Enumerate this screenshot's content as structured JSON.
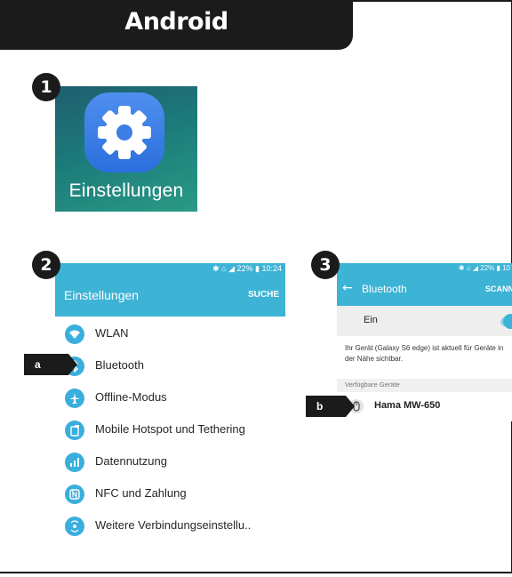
{
  "header": {
    "title": "Android"
  },
  "steps": {
    "step1": "1",
    "step2": "2",
    "step3": "3"
  },
  "app_tile": {
    "label": "Einstellungen",
    "icon": "gear-icon"
  },
  "screen2": {
    "status": "✱ ⌂ ◢ 22% ▮ 10:24",
    "title": "Einstellungen",
    "search": "SUCHE",
    "items": [
      {
        "label": "WLAN",
        "icon": "wifi-icon"
      },
      {
        "label": "Bluetooth",
        "icon": "bluetooth-icon"
      },
      {
        "label": "Offline-Modus",
        "icon": "airplane-icon"
      },
      {
        "label": "Mobile Hotspot und Tethering",
        "icon": "hotspot-icon"
      },
      {
        "label": "Datennutzung",
        "icon": "data-usage-icon"
      },
      {
        "label": "NFC und Zahlung",
        "icon": "nfc-icon"
      },
      {
        "label": "Weitere Verbindungseinstellu..",
        "icon": "more-connections-icon"
      }
    ]
  },
  "screen3": {
    "status": "✱ ⌂ ◢ 22% ▮ 10",
    "back": "←",
    "title": "Bluetooth",
    "scan": "SCANN",
    "toggle_label": "Ein",
    "info": "Ihr Gerät (Galaxy S6 edge) ist aktuell für Geräte in der Nähe sichtbar.",
    "section": "Verfügbare Geräte",
    "device": "Hama MW-650"
  },
  "callouts": {
    "a": "a",
    "b": "b"
  },
  "colors": {
    "header_bg": "#1b1b1b",
    "android_blue": "#3db3d5",
    "icon_blue": "#3aaedc"
  }
}
